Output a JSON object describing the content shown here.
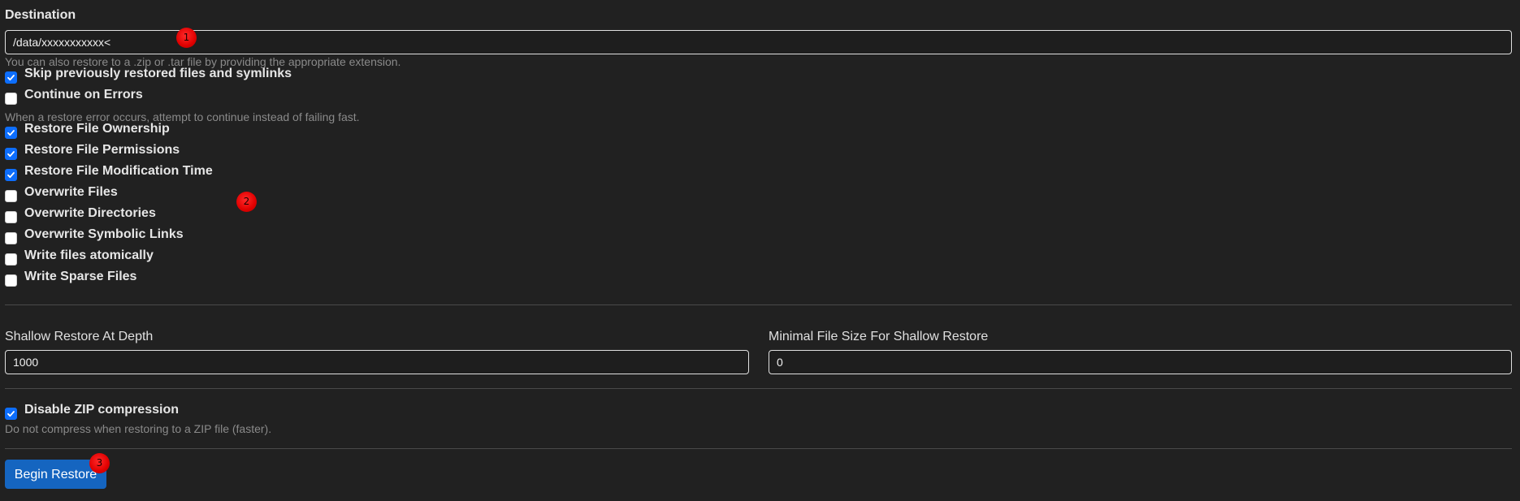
{
  "destination": {
    "label": "Destination",
    "value": "/data/xxxxxxxxxxx<",
    "help": "You can also restore to a .zip or .tar file by providing the appropriate extension."
  },
  "options": [
    {
      "label": "Skip previously restored files and symlinks",
      "checked": true
    },
    {
      "label": "Continue on Errors",
      "checked": false,
      "help": "When a restore error occurs, attempt to continue instead of failing fast."
    },
    {
      "label": "Restore File Ownership",
      "checked": true
    },
    {
      "label": "Restore File Permissions",
      "checked": true
    },
    {
      "label": "Restore File Modification Time",
      "checked": true
    },
    {
      "label": "Overwrite Files",
      "checked": false
    },
    {
      "label": "Overwrite Directories",
      "checked": false
    },
    {
      "label": "Overwrite Symbolic Links",
      "checked": false
    },
    {
      "label": "Write files atomically",
      "checked": false
    },
    {
      "label": "Write Sparse Files",
      "checked": false
    }
  ],
  "shallow": {
    "depth_label": "Shallow Restore At Depth",
    "depth_value": "1000",
    "minsize_label": "Minimal File Size For Shallow Restore",
    "minsize_value": "0"
  },
  "zip": {
    "label": "Disable ZIP compression",
    "checked": true,
    "help": "Do not compress when restoring to a ZIP file (faster)."
  },
  "actions": {
    "begin_restore": "Begin Restore"
  },
  "markers": [
    "1",
    "2",
    "3"
  ],
  "colors": {
    "background": "#212121",
    "accent": "#0d6efd",
    "button": "#1565c0",
    "marker": "#e00000"
  }
}
